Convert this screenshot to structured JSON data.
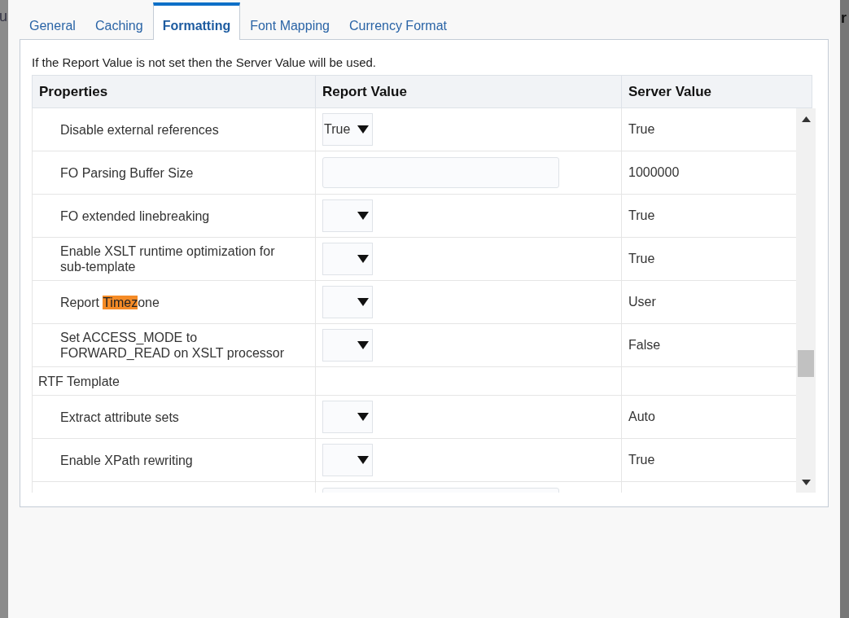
{
  "background_fragments": {
    "left": "u",
    "right": "r"
  },
  "tabs": [
    {
      "label": "General",
      "selected": false
    },
    {
      "label": "Caching",
      "selected": false
    },
    {
      "label": "Formatting",
      "selected": true
    },
    {
      "label": "Font Mapping",
      "selected": false
    },
    {
      "label": "Currency Format",
      "selected": false
    }
  ],
  "info_text": "If the Report Value is not set then the Server Value will be used.",
  "table": {
    "columns": [
      "Properties",
      "Report Value",
      "Server Value"
    ],
    "rows": [
      {
        "kind": "setting",
        "property": [
          {
            "text": "Disable external references",
            "highlighted": false
          }
        ],
        "report_value": {
          "kind": "select",
          "value": "True"
        },
        "server_value": "True"
      },
      {
        "kind": "setting",
        "property": [
          {
            "text": "FO Parsing Buffer Size",
            "highlighted": false
          }
        ],
        "report_value": {
          "kind": "text"
        },
        "server_value": "1000000"
      },
      {
        "kind": "setting",
        "property": [
          {
            "text": "FO extended linebreaking",
            "highlighted": false
          }
        ],
        "report_value": {
          "kind": "select"
        },
        "server_value": "True"
      },
      {
        "kind": "setting",
        "property": [
          {
            "text": "Enable XSLT runtime optimization for sub-template",
            "highlighted": false
          }
        ],
        "report_value": {
          "kind": "select"
        },
        "server_value": "True"
      },
      {
        "kind": "setting",
        "property": [
          {
            "text": "Report ",
            "highlighted": false
          },
          {
            "text": "Timez",
            "highlighted": true
          },
          {
            "text": "one",
            "highlighted": false
          }
        ],
        "report_value": {
          "kind": "select"
        },
        "server_value": "User"
      },
      {
        "kind": "setting",
        "property": [
          {
            "text": "Set ACCESS_MODE to FORWARD_READ on XSLT processor",
            "highlighted": false
          }
        ],
        "report_value": {
          "kind": "select"
        },
        "server_value": "False"
      },
      {
        "kind": "group",
        "property": [
          {
            "text": "RTF Template",
            "highlighted": false
          }
        ]
      },
      {
        "kind": "setting",
        "property": [
          {
            "text": "Extract attribute sets",
            "highlighted": false
          }
        ],
        "report_value": {
          "kind": "select"
        },
        "server_value": "Auto"
      },
      {
        "kind": "setting",
        "property": [
          {
            "text": "Enable XPath rewriting",
            "highlighted": false
          }
        ],
        "report_value": {
          "kind": "select"
        },
        "server_value": "True"
      },
      {
        "kind": "setting",
        "report_value": {
          "kind": "text"
        }
      }
    ]
  }
}
